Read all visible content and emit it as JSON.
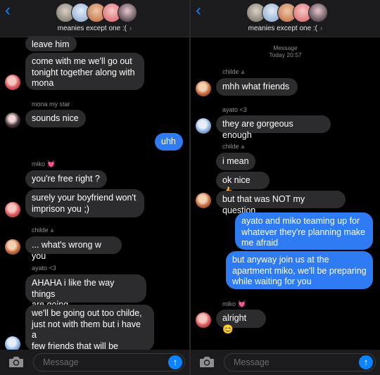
{
  "left": {
    "back_icon": "chevron-left",
    "group_title": "meanies except one :(",
    "group_chevron": "›",
    "messages": {
      "m1": "leave him",
      "m2": "come with me we'll go out\ntonight together along with\nmona",
      "s1": "mona my star",
      "m3": "sounds nice",
      "m4": "uhh",
      "s2": "miko",
      "s2_badge": "💓",
      "m5": "you're free right ?",
      "m6": "surely your boyfriend won't\nimprison you ;)",
      "s3": "childe",
      "s3_badge": "⩓",
      "m7": "... what's wrong w you",
      "s4": "ayato <3",
      "m8": "AHAHA i like the way things\nare going",
      "m9": "we'll be going out too childe,\njust not with them but i have a\nfew friends that will be\ncoming over"
    },
    "composer": {
      "placeholder": "Message",
      "send_icon": "↑"
    }
  },
  "right": {
    "back_icon": "chevron-left",
    "group_title": "meanies except one :(",
    "group_chevron": "›",
    "meta_line1": "Message",
    "meta_line2": "Today 20:57",
    "messages": {
      "s1": "childe",
      "s1_badge": "⩓",
      "m1": "mhh what friends",
      "s2": "ayato <3",
      "m2": "they are gorgeous enough",
      "s3": "childe",
      "s3_badge": "⩓",
      "m3": "i mean",
      "m4": "ok nice 👍",
      "m5": "but that was NOT my question",
      "m6": "ayato and miko teaming up for\nwhatever they're planning make\nme afraid",
      "m7": "but anyway join us at the\napartment miko, we'll be preparing\nwhile waiting for you",
      "s4": "miko",
      "s4_badge": "💓",
      "m8": "alright 😊"
    },
    "composer": {
      "placeholder": "Message",
      "send_icon": "↑"
    }
  },
  "colors": {
    "background": "#000000",
    "incoming_bubble": "#2c2c2e",
    "outgoing_bubble": "#2f7bf4",
    "accent": "#0a84ff"
  }
}
